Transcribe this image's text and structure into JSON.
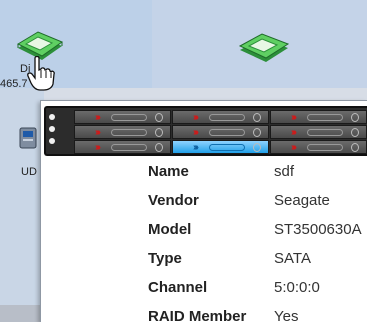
{
  "tiles": [
    {
      "label": "Di",
      "sublabel": "465.7",
      "icon": "disk-icon"
    },
    {
      "label": "",
      "sublabel": "",
      "icon": "disk-icon"
    }
  ],
  "side_item": {
    "label": "UD",
    "icon": "usb-device-icon"
  },
  "enclosure": {
    "rows": 3,
    "columns": 3,
    "active_bay": {
      "row": 3,
      "column": 2
    },
    "status_color": "#1da0e8"
  },
  "details": [
    {
      "key": "Name",
      "value": "sdf"
    },
    {
      "key": "Vendor",
      "value": "Seagate"
    },
    {
      "key": "Model",
      "value": "ST3500630A"
    },
    {
      "key": "Type",
      "value": "SATA"
    },
    {
      "key": "Channel",
      "value": "5:0:0:0"
    },
    {
      "key": "RAID Member",
      "value": "Yes"
    }
  ],
  "colors": {
    "disk_green": "#3bb54a",
    "bay_arrow": "#d41818",
    "active_bay": "#21a0e8"
  }
}
